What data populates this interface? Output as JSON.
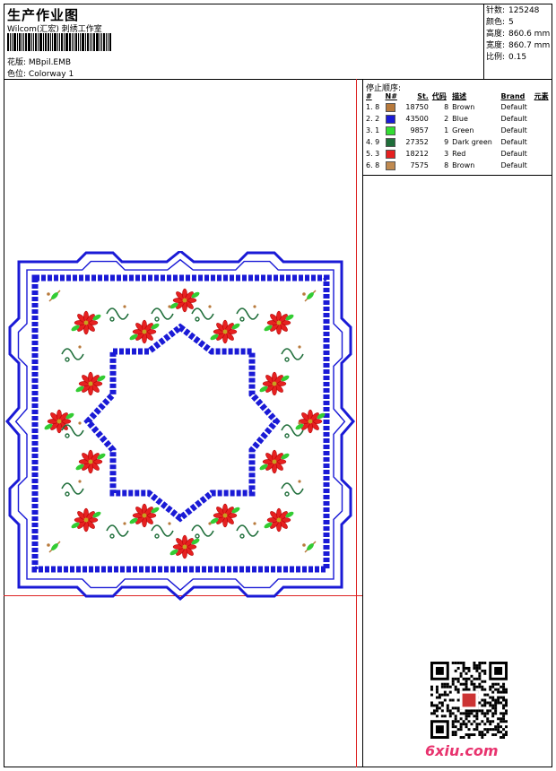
{
  "header": {
    "title": "生产作业图",
    "subtitle": "Wilcom(汇宏) 刺绣工作室",
    "design_label": "花版:",
    "design_value": "MBpil.EMB",
    "colorway_label": "色位:",
    "colorway_value": "Colorway 1"
  },
  "stats": [
    {
      "label": "针数:",
      "value": "125248"
    },
    {
      "label": "颜色:",
      "value": "5"
    },
    {
      "label": "高度:",
      "value": "860.6 mm"
    },
    {
      "label": "宽度:",
      "value": "860.7 mm"
    },
    {
      "label": "比例:",
      "value": "0.15"
    }
  ],
  "stop_sequence": {
    "title": "停止顺序:",
    "headers": [
      "#",
      "N#",
      "St.",
      "代码",
      "描述",
      "Brand",
      "元素"
    ],
    "rows": [
      {
        "idx": "1. 8",
        "color": "#b87a3c",
        "st": "18750",
        "code": "8",
        "desc": "Brown",
        "brand": "Default"
      },
      {
        "idx": "2. 2",
        "color": "#1a1ad6",
        "st": "43500",
        "code": "2",
        "desc": "Blue",
        "brand": "Default"
      },
      {
        "idx": "3. 1",
        "color": "#33dd33",
        "st": "9857",
        "code": "1",
        "desc": "Green",
        "brand": "Default"
      },
      {
        "idx": "4. 9",
        "color": "#1f6e3a",
        "st": "27352",
        "code": "9",
        "desc": "Dark green",
        "brand": "Default"
      },
      {
        "idx": "5. 3",
        "color": "#e62020",
        "st": "18212",
        "code": "3",
        "desc": "Red",
        "brand": "Default"
      },
      {
        "idx": "6. 8",
        "color": "#c08a50",
        "st": "7575",
        "code": "8",
        "desc": "Brown",
        "brand": "Default"
      }
    ]
  },
  "watermark": "6xiu.com",
  "colors": {
    "blue": "#1a1ad6",
    "red": "#e62020",
    "green": "#33cc33",
    "dark_green": "#1f6e3a",
    "brown": "#b87a3c",
    "guide_red": "#d22222"
  }
}
